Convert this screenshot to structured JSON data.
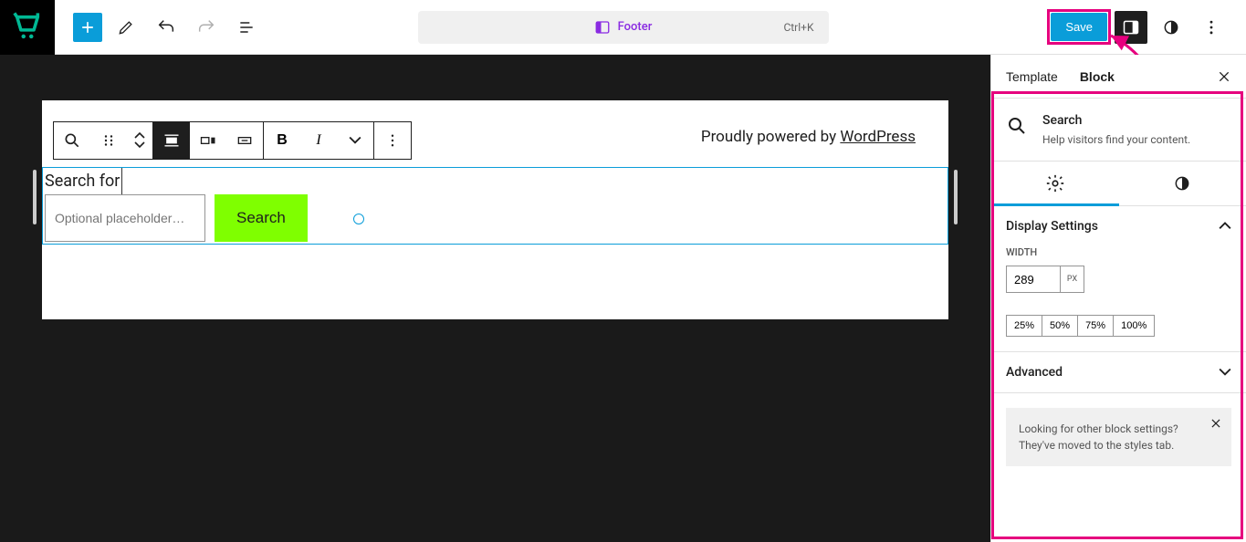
{
  "topbar": {
    "command_center": {
      "label": "Footer",
      "shortcut": "Ctrl+K"
    },
    "save_label": "Save"
  },
  "canvas": {
    "footer_prefix": "Proudly powered by ",
    "footer_link": "WordPress",
    "search_label": "Search for",
    "search_placeholder": "Optional placeholder…",
    "search_button": "Search"
  },
  "sidebar": {
    "tabs": {
      "template": "Template",
      "block": "Block"
    },
    "block_header": {
      "title": "Search",
      "desc": "Help visitors find your content."
    },
    "display_settings": {
      "title": "Display Settings",
      "width_label": "WIDTH",
      "width_value": "289",
      "width_unit": "PX",
      "presets": [
        "25%",
        "50%",
        "75%",
        "100%"
      ]
    },
    "advanced": {
      "title": "Advanced"
    },
    "notice": "Looking for other block settings? They've moved to the styles tab."
  }
}
